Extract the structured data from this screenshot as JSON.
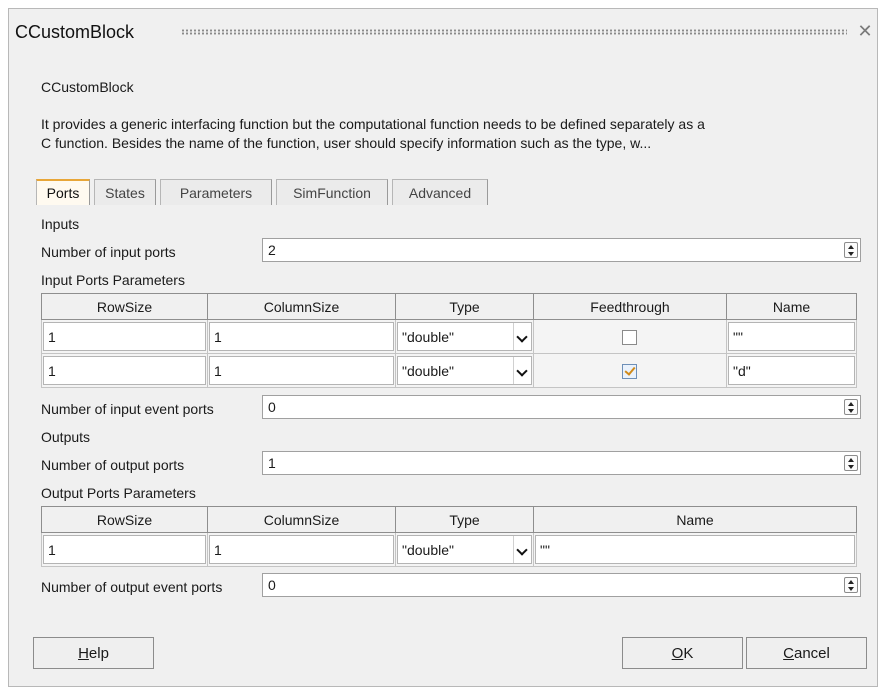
{
  "window": {
    "title": "CCustomBlock",
    "close_glyph": "✕"
  },
  "header": {
    "block_name": "CCustomBlock",
    "description_line1": "It provides a generic interfacing function but the computational function needs to be defined separately as a",
    "description_line2": "C function. Besides the name of the function, user should specify information such as the type, w..."
  },
  "tabs": [
    {
      "label": "Ports",
      "active": true
    },
    {
      "label": "States",
      "active": false
    },
    {
      "label": "Parameters",
      "active": false
    },
    {
      "label": "SimFunction",
      "active": false
    },
    {
      "label": "Advanced",
      "active": false
    }
  ],
  "ports": {
    "inputs_heading": "Inputs",
    "num_input_ports_label": "Number of input ports",
    "num_input_ports_value": "2",
    "input_params_heading": "Input Ports Parameters",
    "input_columns": [
      "RowSize",
      "ColumnSize",
      "Type",
      "Feedthrough",
      "Name"
    ],
    "input_rows": [
      {
        "row_size": "1",
        "column_size": "1",
        "type": "\"double\"",
        "feedthrough": false,
        "name": "\"\""
      },
      {
        "row_size": "1",
        "column_size": "1",
        "type": "\"double\"",
        "feedthrough": true,
        "name": "\"d\""
      }
    ],
    "num_input_event_ports_label": "Number of input event ports",
    "num_input_event_ports_value": "0",
    "outputs_heading": "Outputs",
    "num_output_ports_label": "Number of output ports",
    "num_output_ports_value": "1",
    "output_params_heading": "Output Ports Parameters",
    "output_columns": [
      "RowSize",
      "ColumnSize",
      "Type",
      "Name"
    ],
    "output_rows": [
      {
        "row_size": "1",
        "column_size": "1",
        "type": "\"double\"",
        "name": "\"\""
      }
    ],
    "num_output_event_ports_label": "Number of output event ports",
    "num_output_event_ports_value": "0"
  },
  "buttons": {
    "help_accel": "H",
    "help_rest": "elp",
    "ok_accel": "O",
    "ok_rest": "K",
    "cancel_accel": "C",
    "cancel_rest": "ancel"
  }
}
